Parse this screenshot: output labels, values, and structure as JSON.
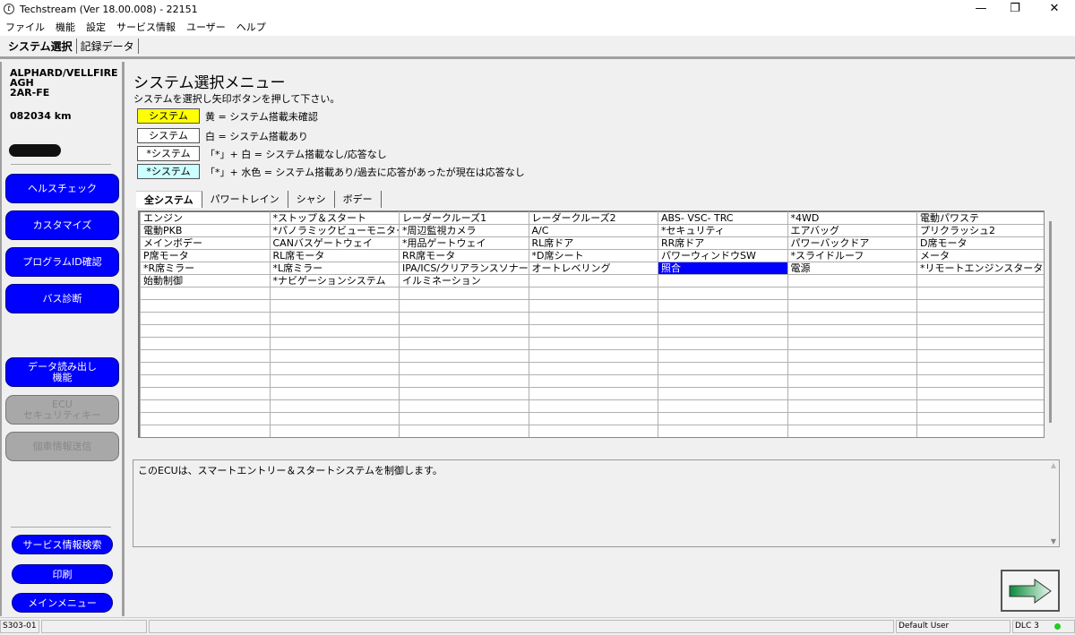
{
  "window": {
    "title": "Techstream (Ver 18.00.008) - 22151",
    "minimize": "—",
    "restore": "❐",
    "close": "✕"
  },
  "menu": [
    "ファイル",
    "機能",
    "設定",
    "サービス情報",
    "ユーザー",
    "ヘルプ"
  ],
  "top_tabs": [
    {
      "label": "システム選択",
      "active": true
    },
    {
      "label": "記録データ",
      "active": false
    }
  ],
  "vehicle": {
    "model": "ALPHARD/VELLFIRE",
    "code": "AGH",
    "engine": "2AR-FE",
    "odometer": "082034 km"
  },
  "left_buttons": [
    "ヘルスチェック",
    "カスタマイズ",
    "プログラムID確認",
    "バス診断",
    "データ読み出し\n機能"
  ],
  "disabled_buttons": [
    "ECU\nセキュリティキー",
    "個車情報送信"
  ],
  "bottom_buttons": [
    "サービス情報検索",
    "印刷",
    "メインメニュー"
  ],
  "main": {
    "title": "システム選択メニュー",
    "instruction": "システムを選択し矢印ボタンを押して下さい。"
  },
  "legend": [
    {
      "box": "システム",
      "color": "#ffff00",
      "text": "黄 = システム搭載未確認"
    },
    {
      "box": "システム",
      "color": "#ffffff",
      "text": "白 = システム搭載あり"
    },
    {
      "box": "*システム",
      "color": "#ffffff",
      "text": "「*」+ 白 = システム搭載なし/応答なし"
    },
    {
      "box": "*システム",
      "color": "#ccffff",
      "text": "「*」+ 水色 = システム搭載あり/過去に応答があったが現在は応答なし"
    }
  ],
  "system_tabs": [
    {
      "label": "全システム",
      "active": true
    },
    {
      "label": "パワートレイン"
    },
    {
      "label": "シャシ"
    },
    {
      "label": "ボデー"
    }
  ],
  "systems": [
    [
      "エンジン",
      "*ストップ＆スタート",
      "レーダークルーズ1",
      "レーダークルーズ2",
      "ABS- VSC- TRC",
      "*4WD",
      "電動パワステ"
    ],
    [
      "電動PKB",
      "*パノラミックビューモニター",
      "*周辺監視カメラ",
      "A/C",
      "*セキュリティ",
      "エアバッグ",
      "プリクラッシュ2"
    ],
    [
      "メインボデー",
      "CANバスゲートウェイ",
      "*用品ゲートウェイ",
      "RL席ドア",
      "RR席ドア",
      "パワーバックドア",
      "D席モータ"
    ],
    [
      "P席モータ",
      "RL席モータ",
      "RR席モータ",
      "*D席シート",
      "パワーウィンドウSW",
      "*スライドルーフ",
      "メータ"
    ],
    [
      "*R席ミラー",
      "*L席ミラー",
      "IPA/ICS/クリアランスソナー",
      "オートレベリング",
      "照合",
      "電源",
      "*リモートエンジンスタータ"
    ],
    [
      "始動制御",
      "*ナビゲーションシステム",
      "イルミネーション",
      "",
      "",
      "",
      ""
    ]
  ],
  "selected": {
    "row": 4,
    "col": 4
  },
  "description": "このECUは、スマートエントリー＆スタートシステムを制御します。",
  "status": {
    "code": "S303-01",
    "user": "Default User",
    "connection": "DLC 3",
    "connection_color": "#22cc22"
  }
}
